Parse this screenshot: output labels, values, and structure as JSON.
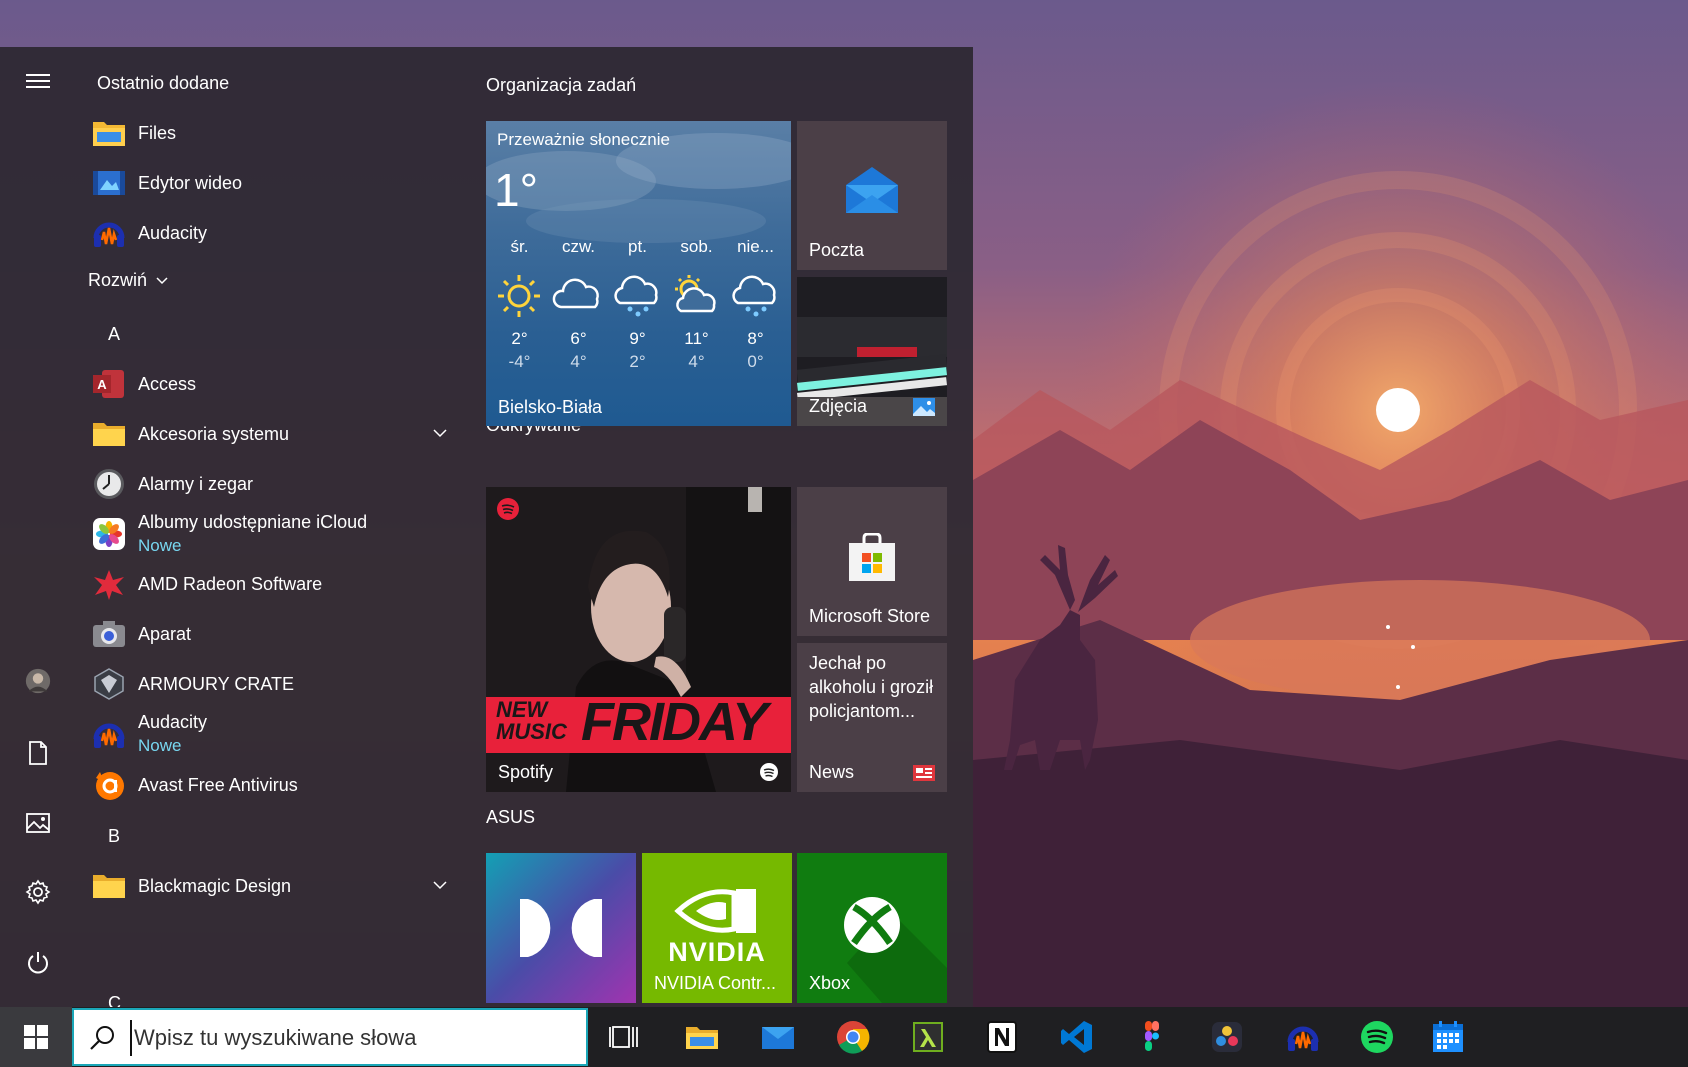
{
  "left_rail": {
    "menu_icon": "hamburger-icon",
    "avatar": "avatar",
    "documents_icon": "document-icon",
    "pictures_icon": "pictures-icon",
    "settings_icon": "gear-icon",
    "power_icon": "power-icon"
  },
  "app_list": {
    "recent_header": "Ostatnio dodane",
    "expand_label": "Rozwiń",
    "new_badge": "Nowe",
    "letters": [
      "A",
      "B",
      "C"
    ],
    "items": [
      {
        "name": "Files"
      },
      {
        "name": "Edytor wideo"
      },
      {
        "name": "Audacity"
      },
      {
        "name": "Access"
      },
      {
        "name": "Akcesoria systemu"
      },
      {
        "name": "Alarmy i zegar"
      },
      {
        "name": "Albumy udostępniane iCloud",
        "badge": "Nowe"
      },
      {
        "name": "AMD Radeon Software"
      },
      {
        "name": "Aparat"
      },
      {
        "name": "ARMOURY CRATE"
      },
      {
        "name": "Audacity",
        "badge": "Nowe"
      },
      {
        "name": "Avast Free Antivirus"
      },
      {
        "name": "Blackmagic Design"
      }
    ]
  },
  "tiles": {
    "groups": [
      "Organizacja zadań",
      "Odkrywanie",
      "ASUS"
    ],
    "weather": {
      "condition": "Przeważnie słonecznie",
      "temperature": "1°",
      "city": "Bielsko-Biała",
      "days": [
        {
          "day": "śr.",
          "hi": "2°",
          "lo": "-4°",
          "icon": "sun-icon"
        },
        {
          "day": "czw.",
          "hi": "6°",
          "lo": "4°",
          "icon": "cloud-icon"
        },
        {
          "day": "pt.",
          "hi": "9°",
          "lo": "2°",
          "icon": "rain-cloud-icon"
        },
        {
          "day": "sob.",
          "hi": "11°",
          "lo": "4°",
          "icon": "partly-sunny-icon"
        },
        {
          "day": "nie...",
          "hi": "8°",
          "lo": "0°",
          "icon": "rain-cloud-icon"
        }
      ]
    },
    "mail": "Poczta",
    "photos": "Zdjęcia",
    "spotify": {
      "label": "Spotify",
      "poster_text_1": "NEW",
      "poster_text_2": "MUSIC",
      "poster_text_3": "FRIDAY"
    },
    "store": "Microsoft Store",
    "news": {
      "headline": "Jechał po alkoholu i groził policjantom...",
      "label": "News"
    },
    "dolby": "",
    "nvidia": {
      "brand": "NVIDIA",
      "label": "NVIDIA Contr..."
    },
    "xbox": "Xbox"
  },
  "taskbar": {
    "search_placeholder": "Wpisz tu wyszukiwane słowa",
    "icons": [
      "windows-icon",
      "search-icon",
      "task-view-icon",
      "file-explorer-icon",
      "mail-icon",
      "chrome-icon",
      "lambda-app-icon",
      "notion-icon",
      "vscode-icon",
      "figma-icon",
      "davinci-icon",
      "audacity-icon",
      "spotify-icon",
      "calendar-icon"
    ]
  },
  "colors": {
    "accent": "#1aa7b8",
    "new_badge": "#78d7f0",
    "menu_bg": "#2f2a34",
    "nvidia_green": "#76b900",
    "xbox_green": "#107c10"
  }
}
